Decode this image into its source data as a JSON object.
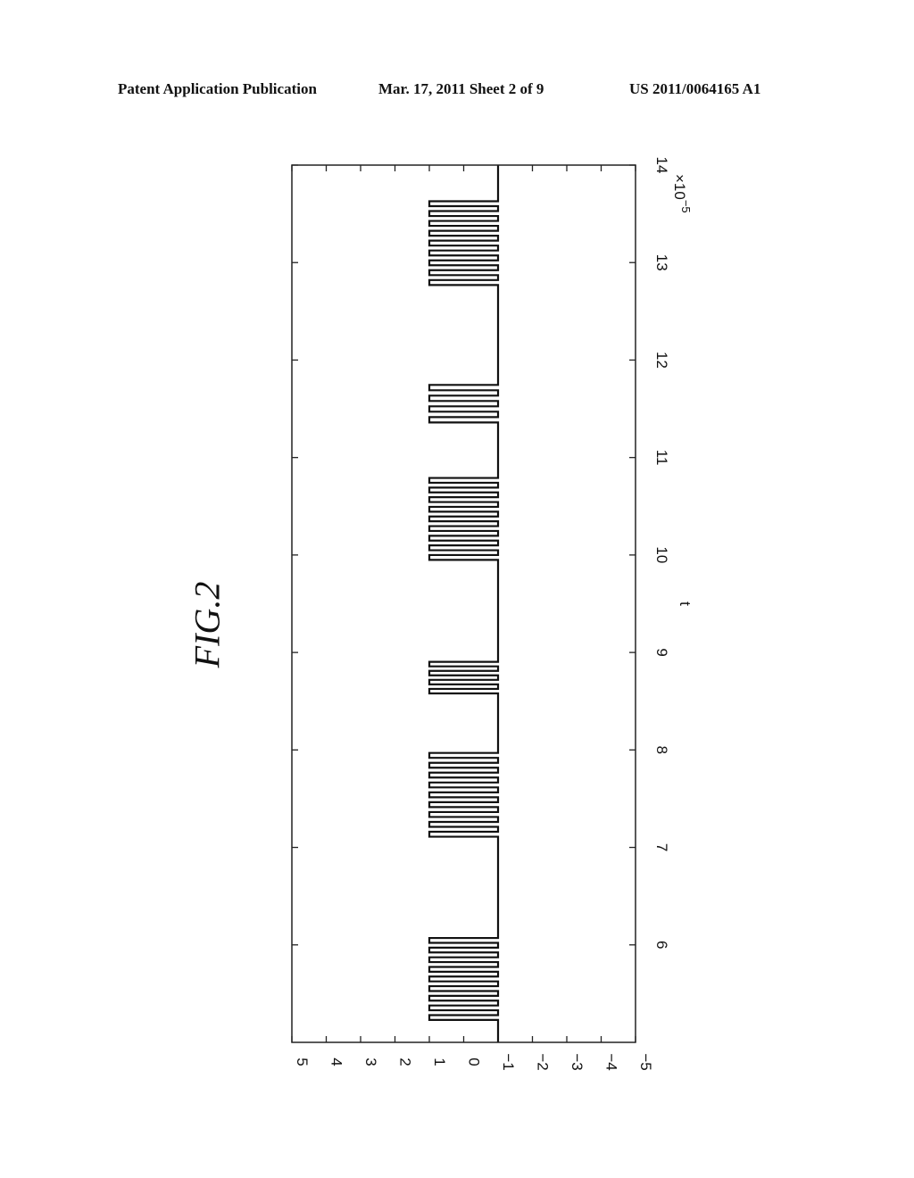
{
  "header": {
    "left": "Patent Application Publication",
    "middle": "Mar. 17, 2011  Sheet 2 of 9",
    "right": "US 2011/0064165 A1"
  },
  "figure_label": "FIG.2",
  "chart_data": {
    "type": "line",
    "orientation": "rotated 90° (t axis vertical, increasing upward on page)",
    "title": "",
    "xlabel": "t",
    "x_multiplier_label": "×10",
    "x_multiplier_exponent": "−5",
    "ylabel": "",
    "xlim": [
      5,
      14
    ],
    "ylim": [
      -5,
      5
    ],
    "x_ticks": [
      6,
      7,
      8,
      9,
      10,
      11,
      12,
      13,
      14
    ],
    "y_ticks": [
      5,
      4,
      3,
      2,
      1,
      0,
      -1,
      -2,
      -3,
      -4,
      -5
    ],
    "y_tick_labels": [
      "5",
      "4",
      "3",
      "2",
      "1",
      "0",
      "−1",
      "−2",
      "−3",
      "−4",
      "−5"
    ],
    "baseline_value": -1,
    "pulse_high_value": 1,
    "grid": false,
    "legend": "none",
    "bursts": [
      {
        "start": 5.23,
        "end": 6.12,
        "pulses": 9
      },
      {
        "start": 7.11,
        "end": 8.02,
        "pulses": 9
      },
      {
        "start": 8.58,
        "end": 8.95,
        "pulses": 4
      },
      {
        "start": 9.95,
        "end": 10.84,
        "pulses": 9
      },
      {
        "start": 11.36,
        "end": 11.8,
        "pulses": 4
      },
      {
        "start": 12.77,
        "end": 13.68,
        "pulses": 9
      }
    ]
  }
}
